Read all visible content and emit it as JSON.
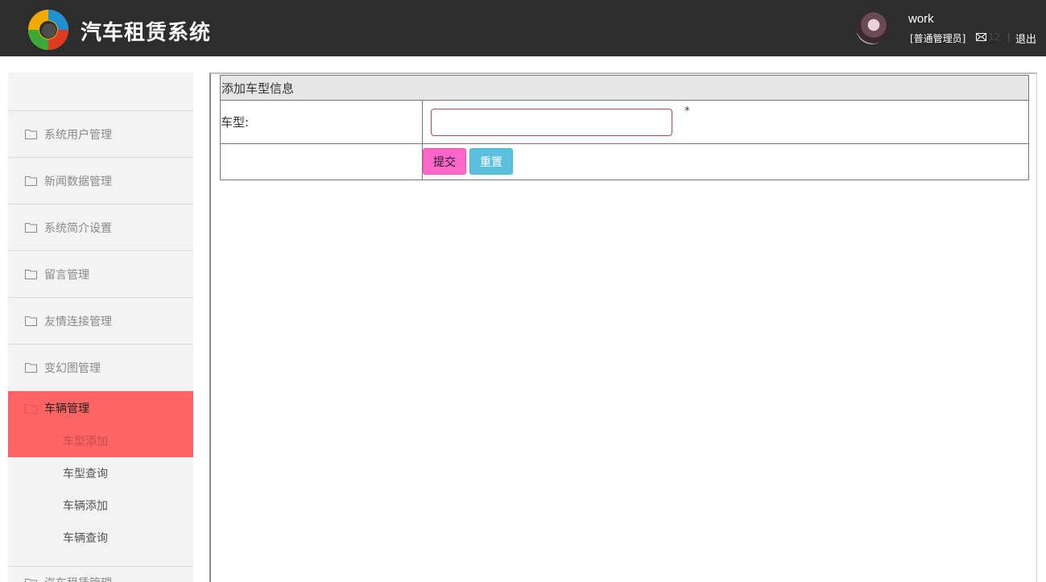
{
  "header": {
    "app_title": "汽车租赁系统",
    "username": "work",
    "role": "[普通管理员]",
    "mail_count": "12",
    "separator": "|",
    "logout_label": "退出"
  },
  "sidebar": {
    "items": [
      {
        "label": "系统用户管理",
        "icon": "folder-icon"
      },
      {
        "label": "新闻数据管理",
        "icon": "folder-icon"
      },
      {
        "label": "系统简介设置",
        "icon": "folder-icon"
      },
      {
        "label": "留言管理",
        "icon": "folder-icon"
      },
      {
        "label": "友情连接管理",
        "icon": "folder-icon"
      },
      {
        "label": "变幻图管理",
        "icon": "folder-icon"
      }
    ],
    "active_group": {
      "label": "车辆管理",
      "current": "车型添加",
      "subitems": [
        "车型查询",
        "车辆添加",
        "车辆查询"
      ]
    },
    "next_item": "汽车租赁管理"
  },
  "form": {
    "title": "添加车型信息",
    "car_type_label": "车型:",
    "car_type_value": "",
    "required_mark": "*",
    "submit_label": "提交",
    "reset_label": "重置"
  },
  "colors": {
    "header_bg": "#2d2d2d",
    "sidebar_bg": "#f3f3f3",
    "active_bg": "#ff6464",
    "submit_bg": "#ff66cc",
    "reset_bg": "#5bc0de"
  }
}
